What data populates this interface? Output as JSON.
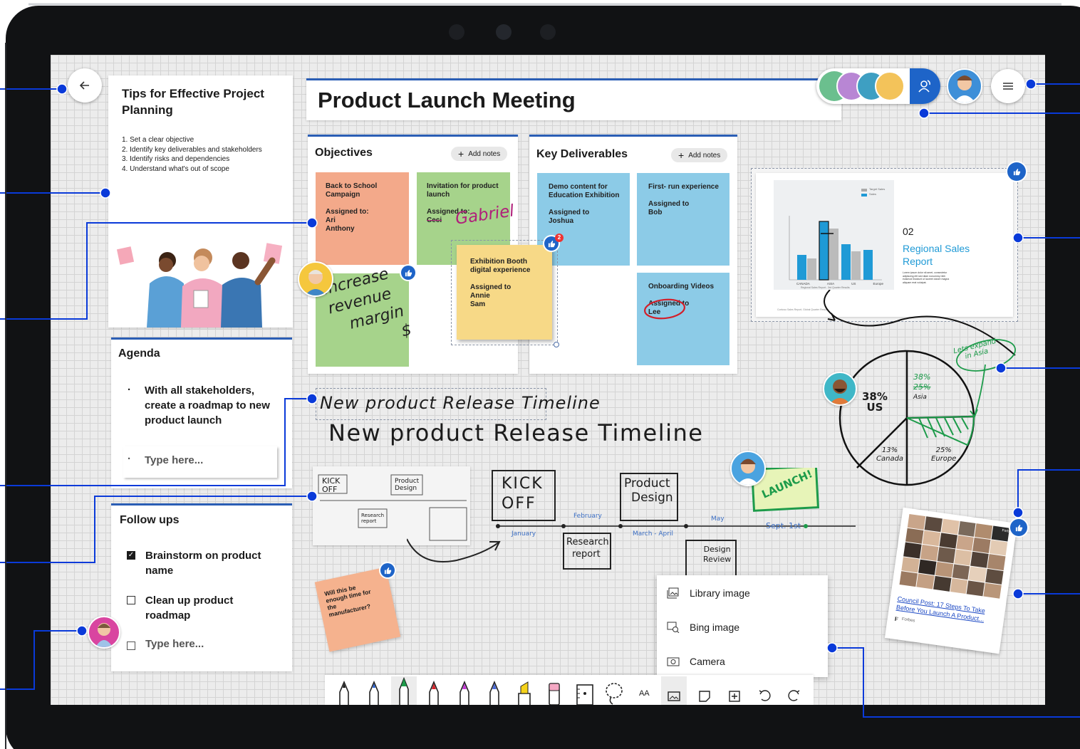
{
  "meeting": {
    "title": "Product Launch Meeting"
  },
  "tips": {
    "title": "Tips for Effective Project Planning",
    "items": [
      "1. Set a clear objective",
      "2. Identify key deliverables and stakeholders",
      "3. Identify risks and dependencies",
      "4. Understand what's out of scope"
    ]
  },
  "agenda": {
    "title": "Agenda",
    "item_1": "With all stakeholders, create a roadmap to new product launch",
    "placeholder": "Type here...",
    "bullet": "·"
  },
  "followups": {
    "title": "Follow ups",
    "items": [
      {
        "label": "Brainstorm on product name",
        "checked": true
      },
      {
        "label": "Clean up product roadmap",
        "checked": false
      }
    ],
    "placeholder": "Type here..."
  },
  "objectives": {
    "title": "Objectives",
    "add_label": "Add notes",
    "notes": {
      "back_to_school": {
        "title": "Back to School Campaign",
        "assigned_label": "Assigned to:",
        "people": [
          "Ari",
          "Anthony"
        ]
      },
      "invitation": {
        "title": "Invitation for product launch",
        "assigned_label": "Assigned to:",
        "struck": "Ceci",
        "handwritten": "Gabriel"
      },
      "revenue": {
        "handwritten": [
          "Increase",
          "revenue",
          "margin",
          "$"
        ]
      }
    }
  },
  "deliverables": {
    "title": "Key Deliverables",
    "add_label": "Add notes",
    "notes": {
      "demo": {
        "title": "Demo content for Education Exhibition",
        "assigned_label": "Assigned to",
        "person": "Joshua"
      },
      "first_run": {
        "title": "First- run experience",
        "assigned_label": "Assigned to",
        "person": "Bob"
      },
      "onboarding": {
        "title": "Onboarding Videos",
        "assigned_label": "Assigned to",
        "person": "Lee"
      }
    }
  },
  "exhibition": {
    "title": "Exhibition Booth digital experience",
    "assigned_label": "Assigned to",
    "people": [
      "Annie",
      "Sam"
    ],
    "like_count": "2"
  },
  "timeline": {
    "title_handwritten": "New product Release Timeline",
    "title_converted": "New product Release Timeline",
    "kickoff": [
      "KICK",
      "OFF"
    ],
    "design": [
      "Product",
      "Design"
    ],
    "research": [
      "Research",
      "report"
    ],
    "review": [
      "Design",
      "Review"
    ],
    "launch": "LAUNCH!",
    "months": [
      "January",
      "February",
      "March - April",
      "May",
      "Sept. 1st"
    ]
  },
  "whiteboard_photo": {
    "kickoff": [
      "KICK",
      "OFF"
    ],
    "design": [
      "Product",
      "Design"
    ],
    "research": [
      "Research",
      "report"
    ]
  },
  "question_note": {
    "text": "Will this be enough time for the manufacturer?"
  },
  "sales_report": {
    "number": "02",
    "title": "Regional Sales Report",
    "body": "Lorem ipsum dolor sit amet, consectetur adipiscing elit sed diam nonummy nibh euismod tincidunt ut laoreet dolore magna aliquam erat volutpat.",
    "legend": [
      "Target Sales",
      "Sales"
    ],
    "categories": [
      "CANADA",
      "ASIA",
      "US",
      "Europe"
    ],
    "caption": "Regional Sales Report - 3rd Quarter Results",
    "footer": "Contoso Sales Report, Global Quarter Results"
  },
  "pie": {
    "us": [
      "38%",
      "US"
    ],
    "asia": [
      "38%",
      "25%",
      "Asia"
    ],
    "canada": [
      "13%",
      "Canada"
    ],
    "europe": [
      "25%",
      "Europe"
    ],
    "note": [
      "Lets expand",
      "in Asia"
    ]
  },
  "article": {
    "link": "Council Post: 17 Steps To Take Before You Launch A Product...",
    "source": "Forbes",
    "brand": "Forbes",
    "brand_initial": "F"
  },
  "insert_menu": {
    "items": [
      "Library image",
      "Bing image",
      "Camera"
    ]
  },
  "toolbar": {
    "tools": [
      "pen-black",
      "pen-blue",
      "pen-green",
      "pen-red",
      "pen-rainbow",
      "pen-galaxy",
      "highlighter-yellow",
      "eraser",
      "ruler",
      "lasso",
      "ink-to-text",
      "insert-image",
      "sticky-note",
      "add-frame",
      "undo",
      "redo"
    ],
    "ink_to_text_label": "AA"
  },
  "colors": {
    "accent": "#1e64c8",
    "orange": "#f3a98a",
    "green": "#a6d38b",
    "blue": "#8ccbe7",
    "yellow": "#f7d987",
    "callout": "#0a3ad9"
  }
}
